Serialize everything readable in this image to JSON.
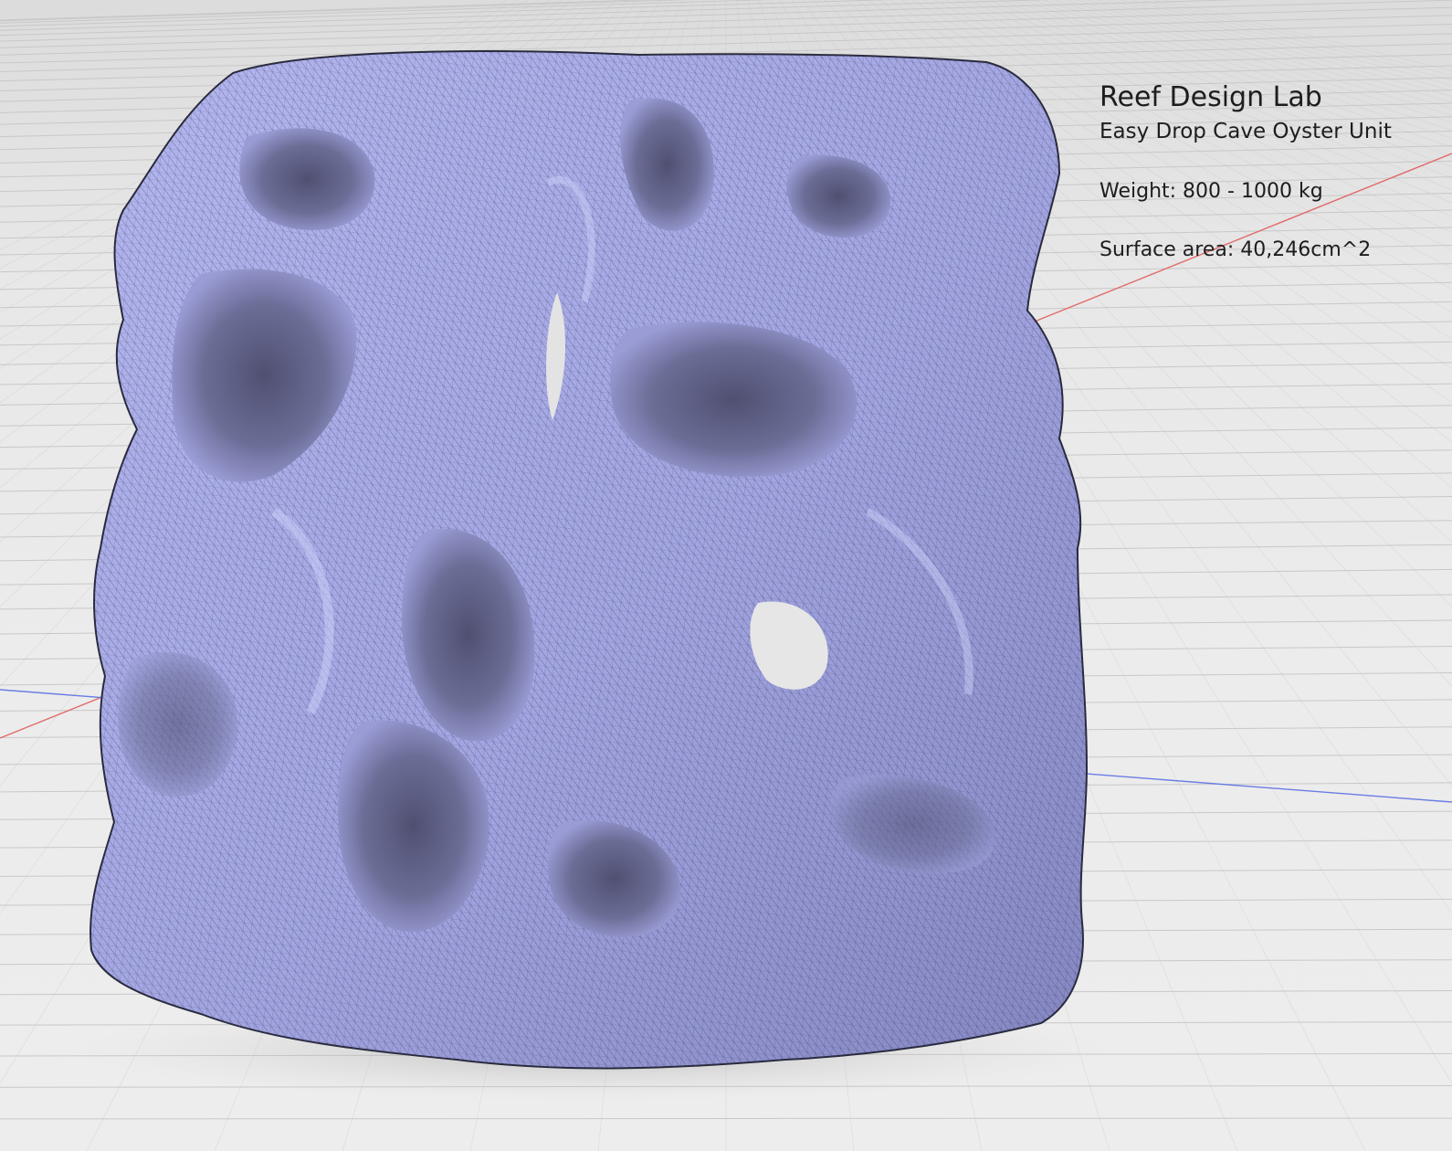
{
  "info": {
    "title": "Reef Design Lab",
    "subtitle": "Easy Drop Cave Oyster Unit",
    "weight": "Weight:  800 - 1000 kg",
    "surface_area": "Surface area: 40,246cm^2"
  },
  "viewport": {
    "background_color": "#e9e9e9",
    "grid_color": "#c8c8c8",
    "x_axis_color": "#e26a6a",
    "y_axis_color": "#6a7ce2",
    "model_color": "#a6a9e6",
    "model_shadow_color": "#3b3c5c",
    "mesh_wire_color": "#2a2b40"
  },
  "model": {
    "name": "cave-oyster-unit-mesh"
  }
}
